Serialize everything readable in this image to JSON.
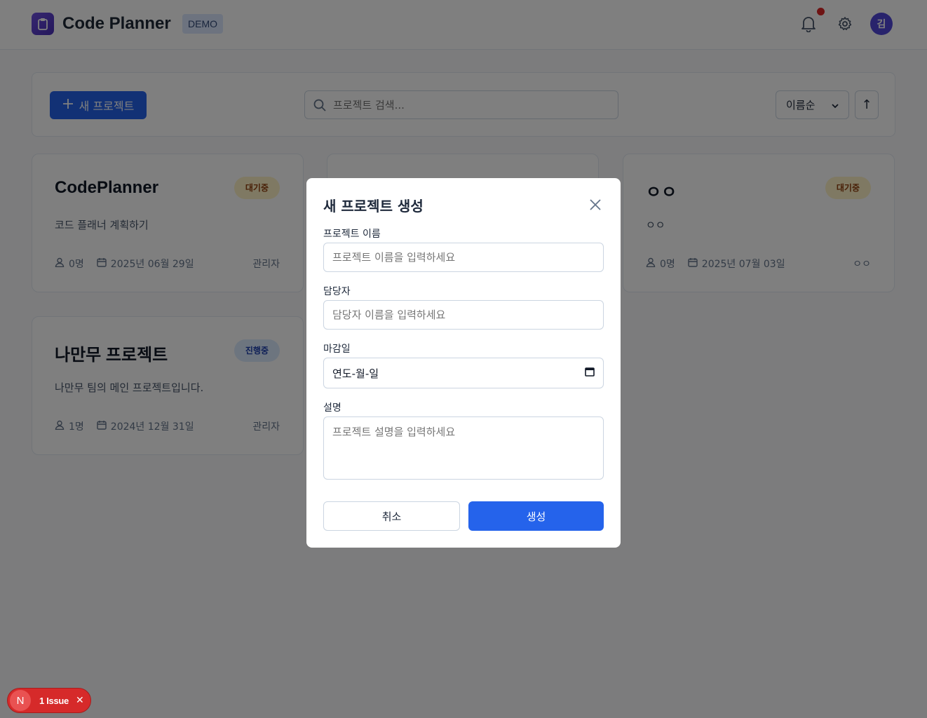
{
  "header": {
    "app_title": "Code Planner",
    "badge": "DEMO",
    "avatar_initial": "김"
  },
  "toolbar": {
    "new_project_label": "새 프로젝트",
    "search_placeholder": "프로젝트 검색...",
    "sort_selected": "이름순",
    "sort_direction": "↑"
  },
  "projects": [
    {
      "title": "CodePlanner",
      "status": "대기중",
      "description": "코드 플래너 계획하기",
      "members": "0명",
      "deadline": "2025년 06월 29일",
      "owner": "관리자"
    },
    {
      "title": "ㅇㅇ",
      "status": "대기중",
      "description": "ㅇㅇ",
      "members": "0명",
      "deadline": "2025년 07월 03일",
      "owner": "ㅇㅇ"
    },
    {
      "title": "나만무 프로젝트",
      "status": "진행중",
      "description": "나만무 팀의 메인 프로젝트입니다.",
      "members": "1명",
      "deadline": "2024년 12월 31일",
      "owner": "관리자"
    }
  ],
  "modal": {
    "title": "새 프로젝트 생성",
    "name_label": "프로젝트 이름",
    "name_placeholder": "프로젝트 이름을 입력하세요",
    "manager_label": "담당자",
    "manager_placeholder": "담당자 이름을 입력하세요",
    "deadline_label": "마감일",
    "deadline_value": "연도-월-일",
    "description_label": "설명",
    "description_placeholder": "프로젝트 설명을 입력하세요",
    "cancel_label": "취소",
    "create_label": "생성"
  },
  "issue_indicator": {
    "letter": "N",
    "text": "1 Issue"
  }
}
